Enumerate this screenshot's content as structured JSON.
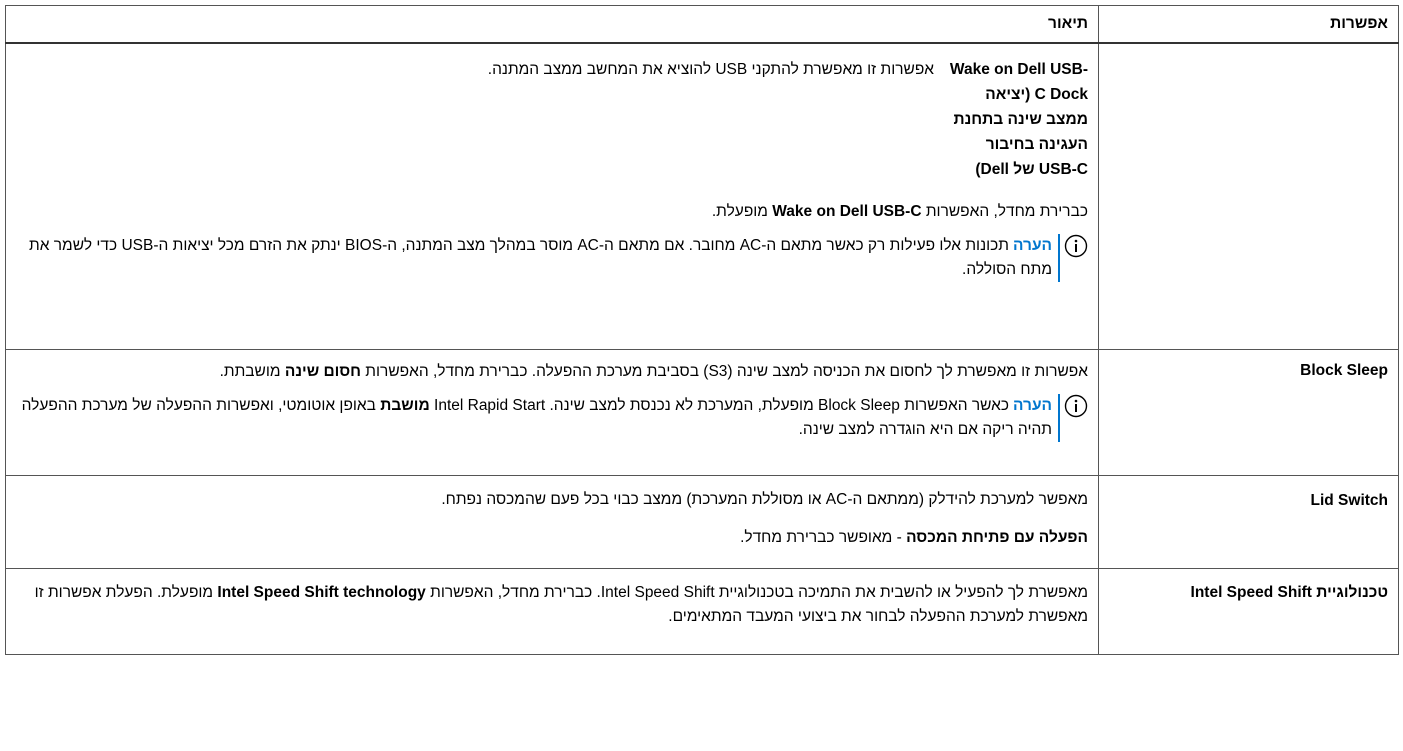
{
  "headers": {
    "option": "אפשרות",
    "description": "תיאור"
  },
  "note_label": "הערה",
  "rows": {
    "wake": {
      "sub_name": "Wake on Dell USB-C Dock (יציאה ממצב שינה בתחנת העגינה בחיבור USB-C של Dell)",
      "sub_desc": "אפשרות זו מאפשרת להתקני USB להוציא את המחשב ממצב המתנה.",
      "default_a": "כברירת מחדל, האפשרות ",
      "default_b": "Wake on Dell USB-C",
      "default_c": " מופעלת.",
      "note_text": "תכונות אלו פעילות רק כאשר מתאם ה-AC מחובר. אם מתאם ה-AC מוסר במהלך מצב המתנה, ה-BIOS ינתק את הזרם מכל יציאות ה-USB כדי לשמר את מתח הסוללה."
    },
    "block_sleep": {
      "option": "Block Sleep",
      "desc_a": "אפשרות זו מאפשרת לך לחסום את הכניסה למצב שינה (S3) בסביבת מערכת ההפעלה. כברירת מחדל, האפשרות ",
      "desc_b": "חסום שינה",
      "desc_c": " מושבתת.",
      "note_a": "כאשר האפשרות Block Sleep מופעלת, המערכת לא נכנסת למצב שינה. Intel Rapid Start ",
      "note_b": "מושבת",
      "note_c": " באופן אוטומטי, ואפשרות ההפעלה של מערכת ההפעלה תהיה ריקה אם היא הוגדרה למצב שינה."
    },
    "lid_switch": {
      "option": "Lid Switch",
      "desc": "מאפשר למערכת להידלק (ממתאם ה-AC או מסוללת המערכת) ממצב כבוי בכל פעם שהמכסה נפתח.",
      "line2_a": "הפעלה עם פתיחת המכסה",
      "line2_b": " - מאופשר כברירת מחדל."
    },
    "speed_shift": {
      "option": "טכנולוגיית Intel Speed Shift",
      "desc_a": "מאפשרת לך להפעיל או להשבית את התמיכה בטכנולוגיית Intel Speed Shift. כברירת מחדל, האפשרות ",
      "desc_b": "Intel Speed Shift technology",
      "desc_c": " מופעלת. הפעלת אפשרות זו מאפשרת למערכת ההפעלה לבחור את ביצועי המעבד המתאימים."
    }
  },
  "colors": {
    "note_accent": "#0076ce",
    "border": "#555555"
  },
  "icons": {
    "note": "info-circle-icon"
  }
}
